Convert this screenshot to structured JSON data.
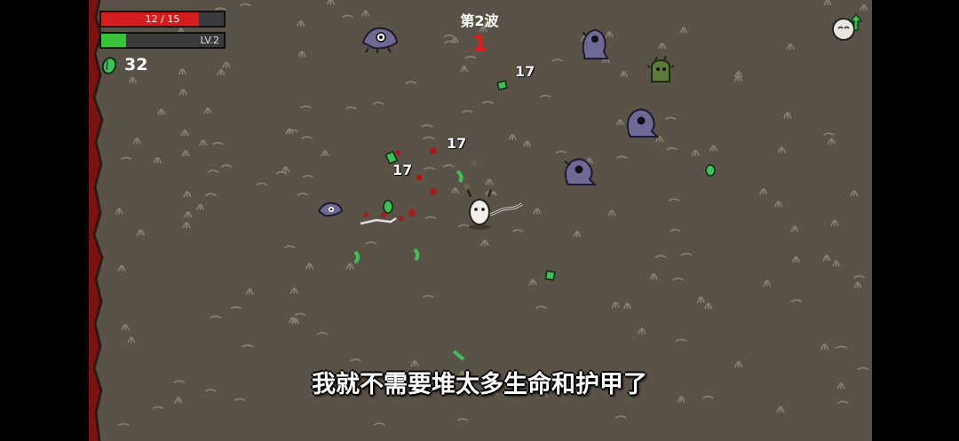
{
  "hud": {
    "hp_text": "12 / 15",
    "hp_fraction": 0.8,
    "level_text": "LV.2",
    "xp_fraction": 0.2,
    "materials_count": "32",
    "wave_label": "第2波",
    "wave_timer": "1"
  },
  "damage_numbers": [
    "17",
    "17",
    "17"
  ],
  "subtitle": "我就不需要堆太多生命和护甲了",
  "colors": {
    "ground": "#5b5247",
    "hp": "#d21e1e",
    "xp": "#39c23a",
    "enemy": "#6e6a95",
    "material": "#3fbf5a",
    "timer": "#e51d1d"
  },
  "icons": {
    "materials": "green-material-icon",
    "upgrade": "potato-upgrade-icon"
  }
}
